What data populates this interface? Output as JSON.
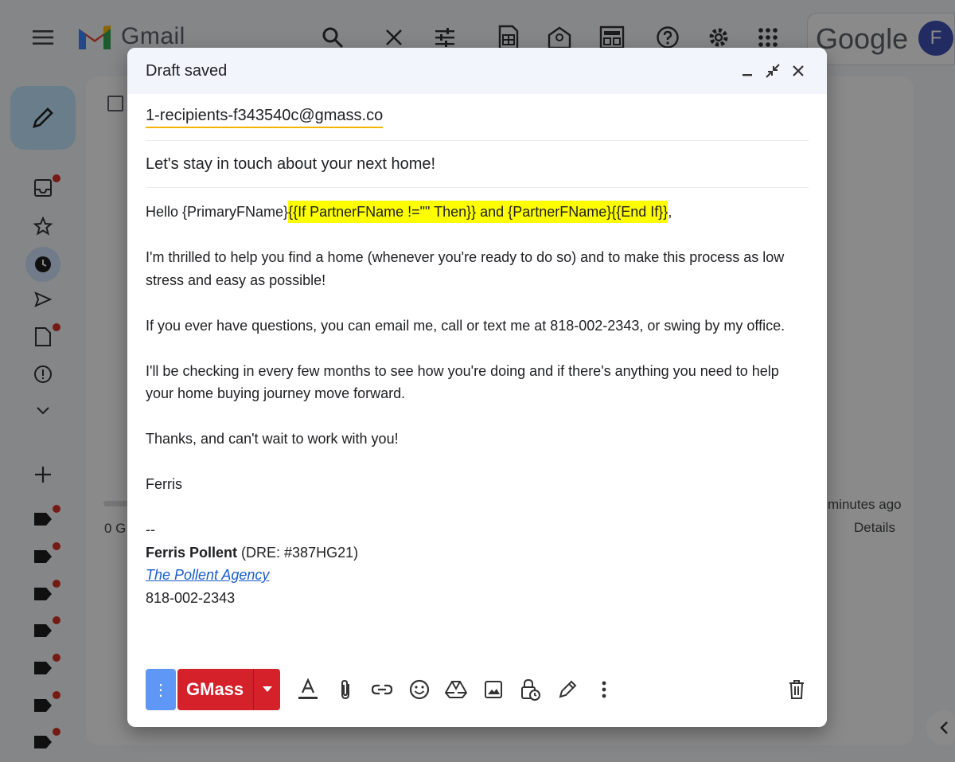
{
  "app": {
    "name": "Gmail",
    "google_label": "Google",
    "avatar_initial": "F"
  },
  "background": {
    "row_time": "minutes ago",
    "row_details": "Details",
    "storage": "0 G"
  },
  "compose": {
    "title": "Draft saved",
    "to": "1-recipients-f343540c@gmass.co",
    "subject": "Let's stay in touch about your next home!",
    "body": {
      "greeting_prefix": "Hello {PrimaryFName}",
      "greeting_highlight": "{{If PartnerFName !=\"\" Then}} and {PartnerFName}{{End If}}",
      "greeting_suffix": ",",
      "p1": "I'm thrilled to help you find a home (whenever you're ready to do so) and to make this process as low stress and easy as possible!",
      "p2": "If you ever have questions, you can email me, call or text me at 818-002-2343, or swing by my office.",
      "p3": "I'll be checking in every few months to see how you're doing and if there's anything you need to help your home buying journey move forward.",
      "p4": "Thanks, and can't wait to work with you!",
      "signoff": "Ferris",
      "sig_dash": "--",
      "sig_name": "Ferris Pollent",
      "sig_dre": " (DRE: #387HG21)",
      "sig_agency": "The Pollent Agency",
      "sig_phone": "818-002-2343"
    },
    "toolbar": {
      "options_label": "⋮",
      "send_label": "GMass"
    }
  },
  "colors": {
    "highlight": "#ffff00",
    "gmass_red": "#d4212a",
    "options_blue": "#5e97f6",
    "link_blue": "#1a5dc9"
  }
}
